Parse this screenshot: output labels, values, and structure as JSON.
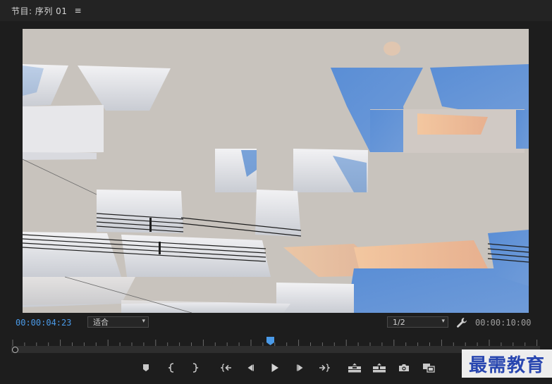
{
  "panel": {
    "title": "节目: 序列 01",
    "menu_icon": "hamburger-menu-icon"
  },
  "viewer": {
    "content": "video-frame-offset-effect"
  },
  "info_bar": {
    "current_timecode": "00:00:04:23",
    "zoom_value": "适合",
    "resolution_value": "1/2",
    "duration_timecode": "00:00:10:00",
    "settings_icon": "wrench-icon"
  },
  "timeline": {
    "playhead_position": 0.49
  },
  "transport": {
    "buttons": [
      {
        "name": "add-marker-button",
        "icon": "marker-icon"
      },
      {
        "name": "mark-in-button",
        "icon": "mark-in-icon"
      },
      {
        "name": "mark-out-button",
        "icon": "mark-out-icon"
      },
      {
        "name": "go-to-in-button",
        "icon": "go-to-in-icon"
      },
      {
        "name": "step-back-button",
        "icon": "step-back-icon"
      },
      {
        "name": "play-button",
        "icon": "play-icon"
      },
      {
        "name": "step-forward-button",
        "icon": "step-forward-icon"
      },
      {
        "name": "go-to-out-button",
        "icon": "go-to-out-icon"
      },
      {
        "name": "lift-button",
        "icon": "lift-icon"
      },
      {
        "name": "extract-button",
        "icon": "extract-icon"
      },
      {
        "name": "export-frame-button",
        "icon": "camera-icon"
      },
      {
        "name": "comparison-view-button",
        "icon": "comparison-view-icon"
      }
    ]
  },
  "watermark": {
    "text": "最需教育"
  },
  "colors": {
    "accent": "#4a9ae8",
    "panel_bg": "#1d1d1d",
    "sky_blue": "#5b8fd2",
    "backdrop": "#c8c3bd"
  }
}
